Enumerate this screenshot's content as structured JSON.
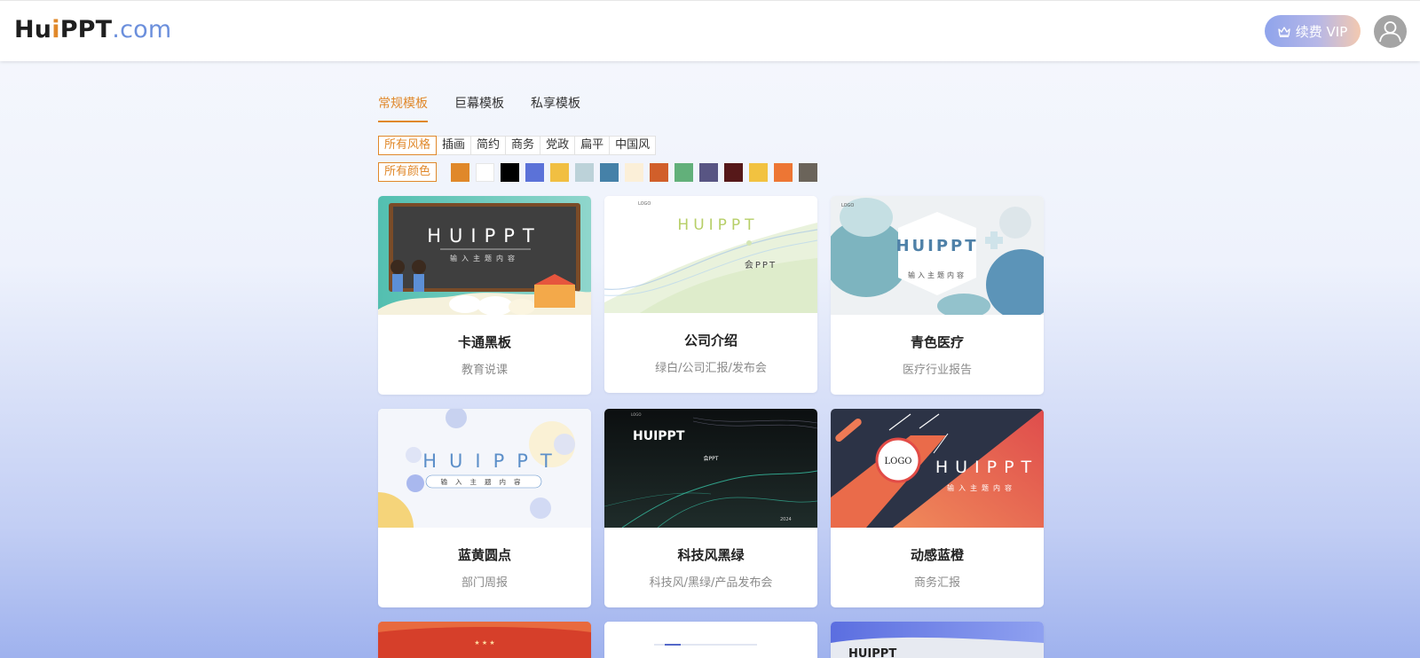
{
  "header": {
    "logo": {
      "hu": "Hu",
      "i": "i",
      "ppt": "PPT",
      "com": ".com"
    },
    "vip_label": "续费 VIP"
  },
  "tabs": [
    {
      "label": "常规模板",
      "active": true
    },
    {
      "label": "巨幕模板",
      "active": false
    },
    {
      "label": "私享模板",
      "active": false
    }
  ],
  "style_filters": [
    "所有风格",
    "插画",
    "简约",
    "商务",
    "党政",
    "扁平",
    "中国风"
  ],
  "color_filter": {
    "label": "所有颜色",
    "swatches": [
      "#e0882a",
      "#ffffff",
      "#000000",
      "#5b72d8",
      "#f1bf42",
      "#bcd2d9",
      "#4581a8",
      "#fbefd8",
      "#d15f2a",
      "#62b07a",
      "#585583",
      "#561819",
      "#f2c240",
      "#ed7634",
      "#6b645a"
    ]
  },
  "cards": [
    {
      "title": "卡通黑板",
      "subtitle": "教育说课",
      "thumb": {
        "brand": "HUIPPT",
        "tagline": "输入主题内容"
      }
    },
    {
      "title": "公司介绍",
      "subtitle": "绿白/公司汇报/发布会",
      "thumb": {
        "brand": "HUIPPT",
        "tagline": "会PPT",
        "logo": "LOGO"
      }
    },
    {
      "title": "青色医疗",
      "subtitle": "医疗行业报告",
      "thumb": {
        "brand": "HUIPPT",
        "tagline": "输入主题内容",
        "logo": "LOGO"
      }
    },
    {
      "title": "蓝黄圆点",
      "subtitle": "部门周报",
      "thumb": {
        "brand": "HUIPPT",
        "tagline": "输入主题内容"
      }
    },
    {
      "title": "科技风黑绿",
      "subtitle": "科技风/黑绿/产品发布会",
      "thumb": {
        "brand": "HUIPPT",
        "tagline": "会PPT",
        "logo": "LOGO",
        "year": "2024"
      }
    },
    {
      "title": "动感蓝橙",
      "subtitle": "商务汇报",
      "thumb": {
        "brand": "HUIPPT",
        "tagline": "输入主题内容",
        "logo": "LOGO"
      }
    },
    {
      "thumb": {
        "brand": "HUIPPT"
      }
    }
  ]
}
